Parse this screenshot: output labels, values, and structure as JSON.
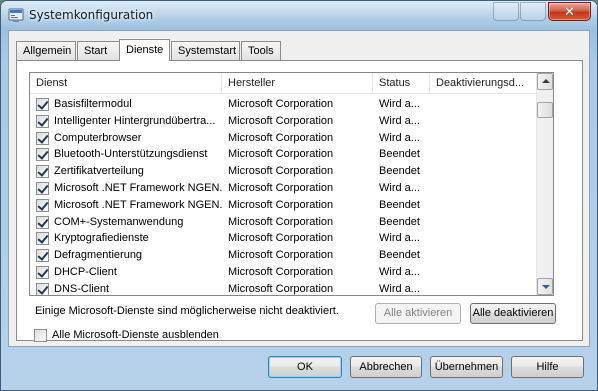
{
  "window": {
    "title": "Systemkonfiguration",
    "close_label": "✕",
    "icon": "msconfig-icon"
  },
  "tabs": [
    {
      "label": "Allgemein",
      "active": false
    },
    {
      "label": "Start",
      "active": false
    },
    {
      "label": "Dienste",
      "active": true
    },
    {
      "label": "Systemstart",
      "active": false
    },
    {
      "label": "Tools",
      "active": false
    }
  ],
  "services": {
    "columns": [
      "Dienst",
      "Hersteller",
      "Status",
      "Deaktivierungsd..."
    ],
    "rows": [
      {
        "name": "Basisfiltermodul",
        "vendor": "Microsoft Corporation",
        "status": "Wird a...",
        "checked": true
      },
      {
        "name": "Intelligenter Hintergrundübertra...",
        "vendor": "Microsoft Corporation",
        "status": "Wird a...",
        "checked": true
      },
      {
        "name": "Computerbrowser",
        "vendor": "Microsoft Corporation",
        "status": "Wird a...",
        "checked": true
      },
      {
        "name": "Bluetooth-Unterstützungsdienst",
        "vendor": "Microsoft Corporation",
        "status": "Beendet",
        "checked": true
      },
      {
        "name": "Zertifikatverteilung",
        "vendor": "Microsoft Corporation",
        "status": "Beendet",
        "checked": true
      },
      {
        "name": "Microsoft .NET Framework NGEN...",
        "vendor": "Microsoft Corporation",
        "status": "Wird a...",
        "checked": true
      },
      {
        "name": "Microsoft .NET Framework NGEN...",
        "vendor": "Microsoft Corporation",
        "status": "Beendet",
        "checked": true
      },
      {
        "name": "COM+-Systemanwendung",
        "vendor": "Microsoft Corporation",
        "status": "Beendet",
        "checked": true
      },
      {
        "name": "Kryptografiedienste",
        "vendor": "Microsoft Corporation",
        "status": "Wird a...",
        "checked": true
      },
      {
        "name": "Defragmentierung",
        "vendor": "Microsoft Corporation",
        "status": "Beendet",
        "checked": true
      },
      {
        "name": "DHCP-Client",
        "vendor": "Microsoft Corporation",
        "status": "Wird a...",
        "checked": true
      },
      {
        "name": "DNS-Client",
        "vendor": "Microsoft Corporation",
        "status": "Wird a...",
        "checked": true
      }
    ]
  },
  "note": "Einige Microsoft-Dienste sind möglicherweise nicht deaktiviert.",
  "buttons": {
    "enable_all": "Alle aktivieren",
    "disable_all": "Alle deaktivieren",
    "ok": "OK",
    "cancel": "Abbrechen",
    "apply": "Übernehmen",
    "help": "Hilfe"
  },
  "hide_ms_checkbox": {
    "label": "Alle Microsoft-Dienste ausblenden",
    "checked": false
  }
}
